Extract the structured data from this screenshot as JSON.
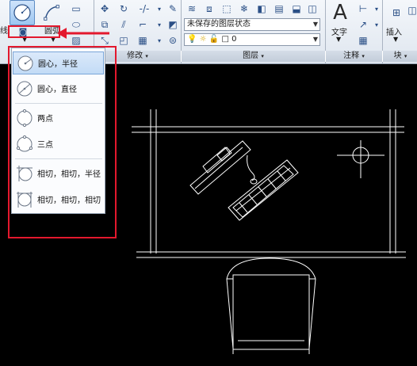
{
  "ribbon": {
    "line_label": "线",
    "arc_label": "圆弧",
    "panels": {
      "modify": "修改",
      "layers": "图层",
      "annotation": "注释",
      "block": "块"
    },
    "layer_state": "未保存的图层状态",
    "layer_current": "0",
    "text_label": "文字",
    "insert_label": "插入"
  },
  "circle_menu": {
    "items": [
      {
        "label": "圆心，半径",
        "icon": "circle-center-radius-icon"
      },
      {
        "label": "圆心，直径",
        "icon": "circle-center-diameter-icon"
      },
      {
        "label": "两点",
        "icon": "circle-2point-icon"
      },
      {
        "label": "三点",
        "icon": "circle-3point-icon"
      },
      {
        "label": "相切，相切，半径",
        "icon": "circle-ttr-icon"
      },
      {
        "label": "相切，相切，相切",
        "icon": "circle-ttt-icon"
      }
    ]
  },
  "colors": {
    "highlight": "#e3182d",
    "canvas": "#000000",
    "drawing": "#ffffff"
  }
}
